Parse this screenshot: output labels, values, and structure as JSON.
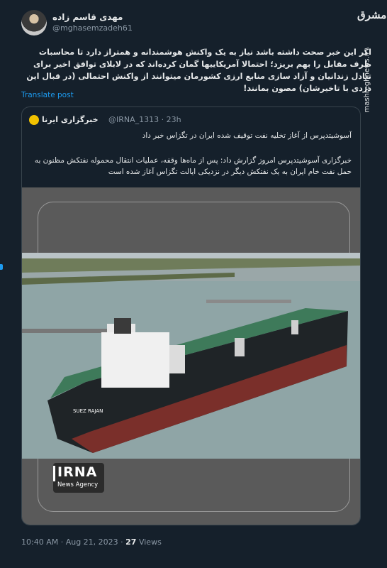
{
  "author": {
    "name": "مهدی قاسم زاده",
    "handle": "@mghasemzadeh61"
  },
  "watermark": {
    "logo": "مشرق",
    "site": "mashreghnews.ir"
  },
  "tweet": {
    "text": "اگر این خبر صحت داشته باشد نیاز به یک واکنش هوشمندانه و همتراز دارد تا محاسبات طرف مقابل را بهم بریزد؛ احتمالا آمریکاییها گمان کرده‌اند که در لابلای توافق اخیر برای تبادل زندانیان و آزاد سازی منابع ارزی کشورمان میتوانند از واکنش احتمالی (در قبال این دزدی با تاخیرشان) مصون بمانند!",
    "translate_label": "Translate post"
  },
  "quote": {
    "name": "خبرگزاری ایرنا",
    "handle_time": "@IRNA_1313 · 23h",
    "title": "آسوشیتدپرس از آغاز تخلیه نفت توقیف شده ایران در تگزاس خبر داد",
    "body": "خبرگزاری آسوشیتدپرس امروز گزارش داد: پس از ماه‌ها وقفه، عملیات انتقال محموله نفتکش مظنون به حمل نفت خام ایران به یک نفتکش دیگر در نزدیکی ایالت تگزاس آغاز شده است"
  },
  "photo": {
    "logo_word": "IRNA",
    "logo_sub": "News Agency",
    "ship_name": "SUEZ RAJAN"
  },
  "meta": {
    "time_date": "10:40 AM · Aug 21, 2023 · ",
    "views_count": "27",
    "views_label": " Views"
  },
  "colors": {
    "background": "#15202b",
    "link": "#1d9bf0",
    "muted": "#8b98a5",
    "irna_yellow": "#f2c200"
  }
}
